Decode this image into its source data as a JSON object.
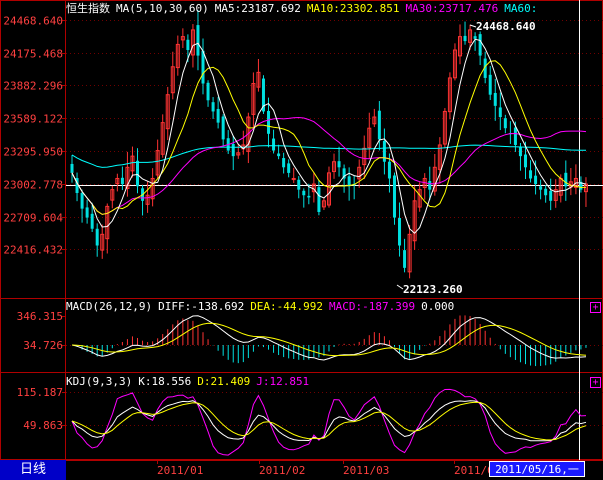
{
  "colors": {
    "up": "#ff3333",
    "down": "#00e0e0",
    "ma5": "#ffffff",
    "ma10": "#ffff00",
    "ma30": "#ff00ff",
    "ma60": "#00ffff",
    "axis": "#b00000",
    "label": "#ff4040",
    "period_bg": "#0000c8"
  },
  "main_header": {
    "index_name": "恒生指数",
    "ma_params": "MA(5,10,30,60)",
    "ma5": "MA5:23187.692",
    "ma10": "MA10:23302.851",
    "ma30": "MA30:23717.476",
    "ma60": "MA60:"
  },
  "price_axis": [
    "24468.640",
    "24175.468",
    "23882.296",
    "23589.122",
    "23295.950",
    "23002.778",
    "22709.604",
    "22416.432"
  ],
  "annotations": {
    "high": "24468.640",
    "low": "22123.260"
  },
  "macd_header": {
    "params": "MACD(26,12,9)",
    "diff": "DIFF:-138.692",
    "dea": "DEA:-44.992",
    "macd": "MACD:-187.399",
    "zero": "0.000"
  },
  "macd_axis": [
    "346.315",
    "34.726"
  ],
  "kdj_header": {
    "params": "KDJ(9,3,3)",
    "k": "K:18.556",
    "d": "D:21.409",
    "j": "J:12.851"
  },
  "kdj_axis": [
    "115.187",
    "49.863"
  ],
  "time_axis": [
    "2011/01",
    "2011/02",
    "2011/03",
    "2011/04"
  ],
  "period_label": "日线",
  "cursor_date": "2011/05/16,一",
  "plus_glyph": "+",
  "chart_data": {
    "type": "candlestick",
    "price_range": [
      22123.26,
      24468.64
    ],
    "high_value": 24468.64,
    "low_value": 22123.26,
    "ma_last": {
      "MA5": 23187.692,
      "MA10": 23302.851,
      "MA30": 23717.476
    },
    "macd_last": {
      "DIFF": -138.692,
      "DEA": -44.992,
      "MACD": -187.399
    },
    "kdj_last": {
      "K": 18.556,
      "D": 21.409,
      "J": 12.851
    },
    "closes": [
      23100,
      22920,
      22780,
      22700,
      22600,
      22450,
      22550,
      22800,
      22950,
      23050,
      23000,
      23150,
      23250,
      22980,
      22850,
      22900,
      23050,
      23300,
      23550,
      23800,
      24050,
      24250,
      24320,
      24200,
      24380,
      24150,
      23900,
      23750,
      23650,
      23550,
      23400,
      23300,
      23250,
      23280,
      23350,
      23600,
      23900,
      24000,
      23650,
      23450,
      23300,
      23250,
      23150,
      23100,
      23050,
      22950,
      22900,
      22880,
      23000,
      22750,
      22850,
      23100,
      23200,
      23150,
      23050,
      22980,
      23000,
      23150,
      23320,
      23500,
      23600,
      23400,
      23200,
      23050,
      22700,
      22450,
      22250,
      22550,
      22850,
      22950,
      23050,
      22950,
      23150,
      23350,
      23650,
      23950,
      24200,
      24320,
      24280,
      24380,
      24300,
      24150,
      23950,
      23800,
      23700,
      23600,
      23500,
      23450,
      23350,
      23250,
      23150,
      23050,
      23000,
      22950,
      22900,
      22850,
      22950,
      23050,
      22980,
      23020,
      23050,
      22950,
      23000
    ]
  }
}
